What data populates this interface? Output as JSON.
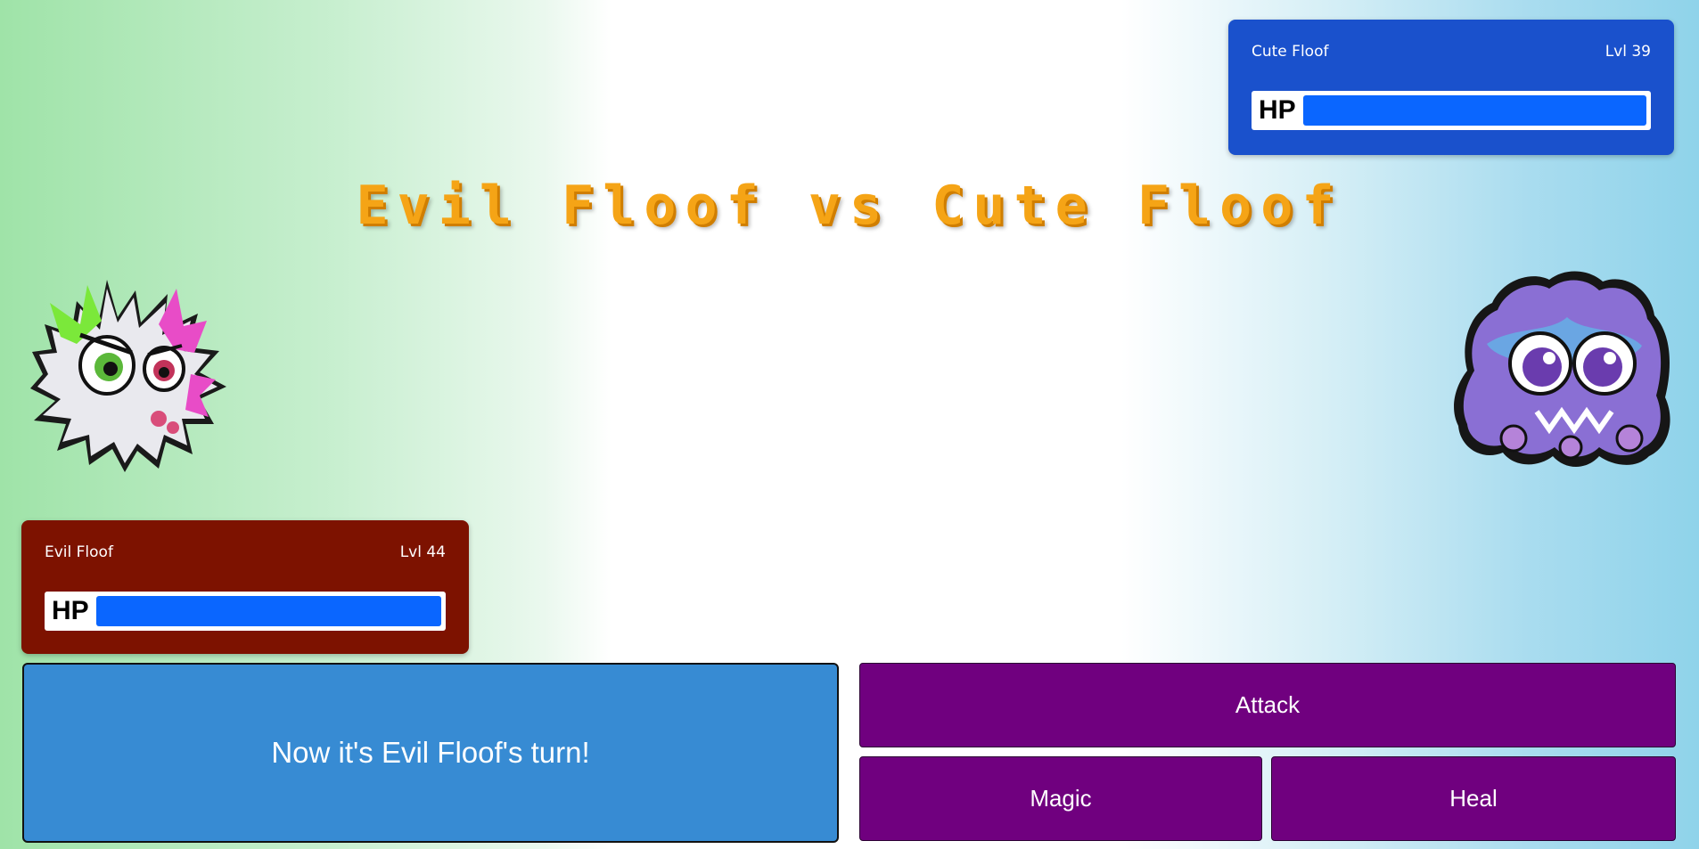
{
  "title": "Evil Floof vs Cute Floof",
  "player": {
    "name": "Evil Floof",
    "level": "Lvl 44",
    "hp_label": "HP",
    "hp_fraction": 1.0,
    "sprite_icon": "evil-floof-monster"
  },
  "enemy": {
    "name": "Cute Floof",
    "level": "Lvl 39",
    "hp_label": "HP",
    "hp_fraction": 1.0,
    "sprite_icon": "cute-floof-monster"
  },
  "message": "Now it's Evil Floof's turn!",
  "actions": {
    "attack": "Attack",
    "magic": "Magic",
    "heal": "Heal"
  },
  "colors": {
    "player_card": "#7d1200",
    "enemy_card": "#1a51cc",
    "hp_fill": "#0a66ff",
    "message_box": "#378bd3",
    "action_button": "#70007f",
    "title": "#f5a416"
  }
}
